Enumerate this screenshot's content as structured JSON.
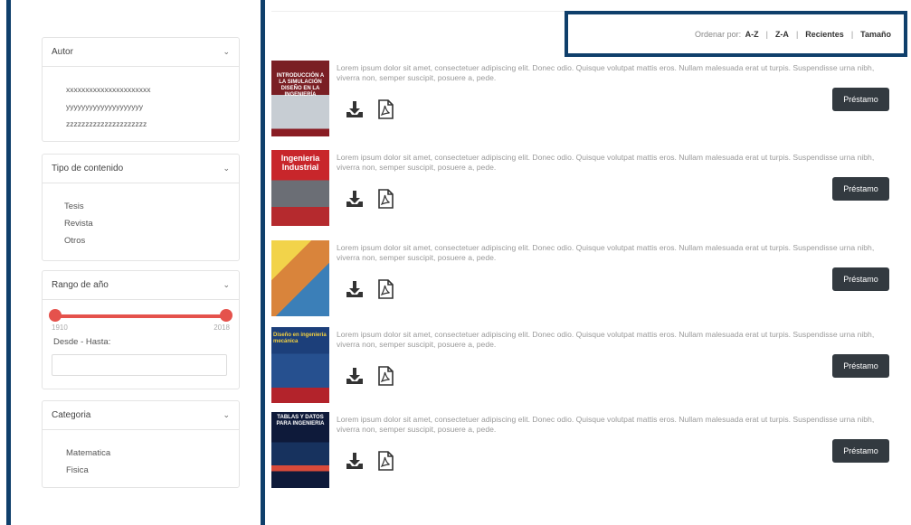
{
  "filters": {
    "autor": {
      "title": "Autor",
      "items": [
        "xxxxxxxxxxxxxxxxxxxxxx",
        "yyyyyyyyyyyyyyyyyyyy",
        "zzzzzzzzzzzzzzzzzzzzz"
      ]
    },
    "tipo": {
      "title": "Tipo de contenido",
      "items": [
        "Tesis",
        "Revista",
        "Otros"
      ]
    },
    "rango": {
      "title": "Rango de año",
      "min": "1910",
      "max": "2018",
      "label": "Desde - Hasta:",
      "input_value": ""
    },
    "categoria": {
      "title": "Categoria",
      "items": [
        "Matematica",
        "Fisica"
      ]
    }
  },
  "sort": {
    "label": "Ordenar por:",
    "options": [
      "A-Z",
      "Z-A",
      "Recientes",
      "Tamaño"
    ],
    "sep": "|"
  },
  "books": [
    {
      "cover_title": "INTRODUCCIÓN A LA SIMULACIÓN DISEÑO EN LA INGENIERÍA",
      "description": "Lorem ipsum dolor sit amet, consectetuer adipiscing elit. Donec odio. Quisque volutpat mattis eros. Nullam malesuada erat ut turpis. Suspendisse urna nibh, viverra non, semper suscipit, posuere a, pede.",
      "button": "Préstamo"
    },
    {
      "cover_title": "Ingenieria Industrial",
      "description": "Lorem ipsum dolor sit amet, consectetuer adipiscing elit. Donec odio. Quisque volutpat mattis eros. Nullam malesuada erat ut turpis. Suspendisse urna nibh, viverra non, semper suscipit, posuere a, pede.",
      "button": "Préstamo"
    },
    {
      "cover_title": "",
      "description": "Lorem ipsum dolor sit amet, consectetuer adipiscing elit. Donec odio. Quisque volutpat mattis eros. Nullam malesuada erat ut turpis. Suspendisse urna nibh, viverra non, semper suscipit, posuere a, pede.",
      "button": "Préstamo"
    },
    {
      "cover_title": "Diseño en ingeniería mecánica",
      "description": "Lorem ipsum dolor sit amet, consectetuer adipiscing elit. Donec odio. Quisque volutpat mattis eros. Nullam malesuada erat ut turpis. Suspendisse urna nibh, viverra non, semper suscipit, posuere a, pede.",
      "button": "Préstamo"
    },
    {
      "cover_title": "TABLAS Y DATOS PARA INGENIERIA",
      "description": "Lorem ipsum dolor sit amet, consectetuer adipiscing elit. Donec odio. Quisque volutpat mattis eros. Nullam malesuada erat ut turpis. Suspendisse urna nibh, viverra non, semper suscipit, posuere a, pede.",
      "button": "Préstamo"
    }
  ],
  "icons": {
    "chevron": "chevron-down-icon",
    "download": "download-icon",
    "pdf": "pdf-icon"
  },
  "colors": {
    "frame": "#0f3f6b",
    "slider": "#e5524c",
    "button": "#333a40"
  }
}
